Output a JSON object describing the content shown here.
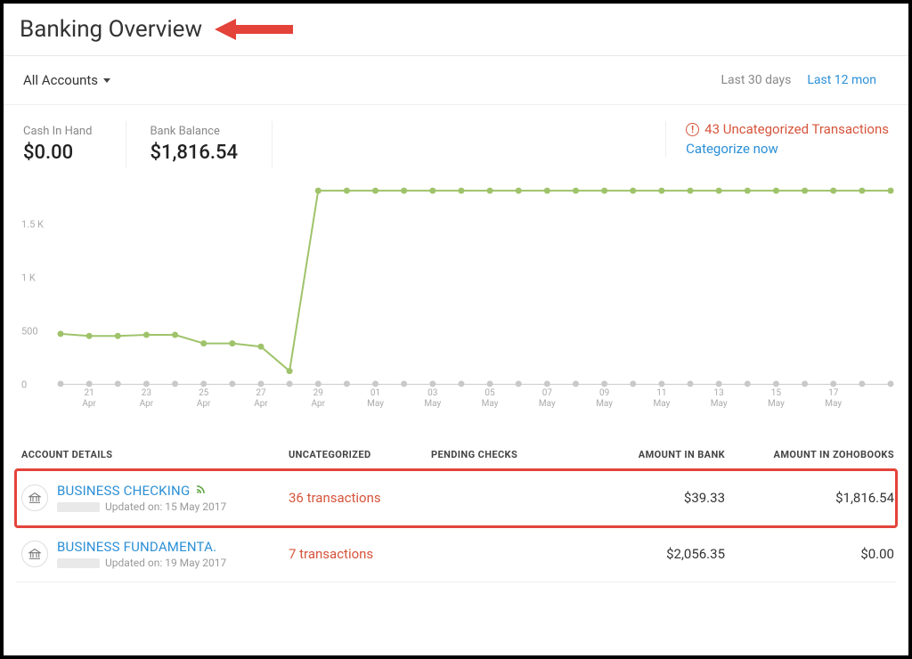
{
  "header": {
    "title": "Banking Overview"
  },
  "toolbar": {
    "account_selector": "All Accounts",
    "range_30": "Last 30 days",
    "range_12": "Last 12 mon"
  },
  "summary": {
    "cash_label": "Cash In Hand",
    "cash_value": "$0.00",
    "bank_label": "Bank Balance",
    "bank_value": "$1,816.54"
  },
  "alert": {
    "line1": "43 Uncategorized Transactions",
    "line2": "Categorize now"
  },
  "chart_data": {
    "type": "line",
    "ylabel": "",
    "ylim": [
      0,
      1800
    ],
    "y_ticks": [
      0,
      500,
      1000,
      1500
    ],
    "y_tick_labels": [
      "0",
      "500",
      "1 K",
      "1.5 K"
    ],
    "x_tick_labels": [
      {
        "top": "21",
        "bottom": "Apr"
      },
      {
        "top": "23",
        "bottom": "Apr"
      },
      {
        "top": "25",
        "bottom": "Apr"
      },
      {
        "top": "27",
        "bottom": "Apr"
      },
      {
        "top": "29",
        "bottom": "Apr"
      },
      {
        "top": "01",
        "bottom": "May"
      },
      {
        "top": "03",
        "bottom": "May"
      },
      {
        "top": "05",
        "bottom": "May"
      },
      {
        "top": "07",
        "bottom": "May"
      },
      {
        "top": "09",
        "bottom": "May"
      },
      {
        "top": "11",
        "bottom": "May"
      },
      {
        "top": "13",
        "bottom": "May"
      },
      {
        "top": "15",
        "bottom": "May"
      },
      {
        "top": "17",
        "bottom": "May"
      }
    ],
    "series": [
      {
        "name": "Bank Balance",
        "color": "#9fc36a",
        "values": [
          470,
          450,
          450,
          460,
          460,
          380,
          380,
          350,
          120,
          1816,
          1816,
          1816,
          1816,
          1816,
          1816,
          1816,
          1816,
          1816,
          1816,
          1816,
          1816,
          1816,
          1816,
          1816,
          1816,
          1816,
          1816,
          1816,
          1816,
          1816
        ]
      },
      {
        "name": "Baseline",
        "color": "#c9c9c9",
        "values": [
          0,
          0,
          0,
          0,
          0,
          0,
          0,
          0,
          0,
          0,
          0,
          0,
          0,
          0,
          0,
          0,
          0,
          0,
          0,
          0,
          0,
          0,
          0,
          0,
          0,
          0,
          0,
          0,
          0,
          0
        ]
      }
    ]
  },
  "table": {
    "headers": {
      "account": "ACCOUNT DETAILS",
      "uncat": "UNCATEGORIZED",
      "pending": "PENDING CHECKS",
      "bank": "AMOUNT IN BANK",
      "books": "AMOUNT IN ZOHOBOOKS"
    },
    "rows": [
      {
        "name": "BUSINESS CHECKING",
        "feed": true,
        "updated": "Updated on: 15 May 2017",
        "uncat": "36 transactions",
        "pending": "",
        "bank": "$39.33",
        "books": "$1,816.54",
        "highlight": true
      },
      {
        "name": "BUSINESS FUNDAMENTA.",
        "feed": false,
        "updated": "Updated on: 19 May 2017",
        "uncat": "7 transactions",
        "pending": "",
        "bank": "$2,056.35",
        "books": "$0.00",
        "highlight": false
      }
    ]
  }
}
